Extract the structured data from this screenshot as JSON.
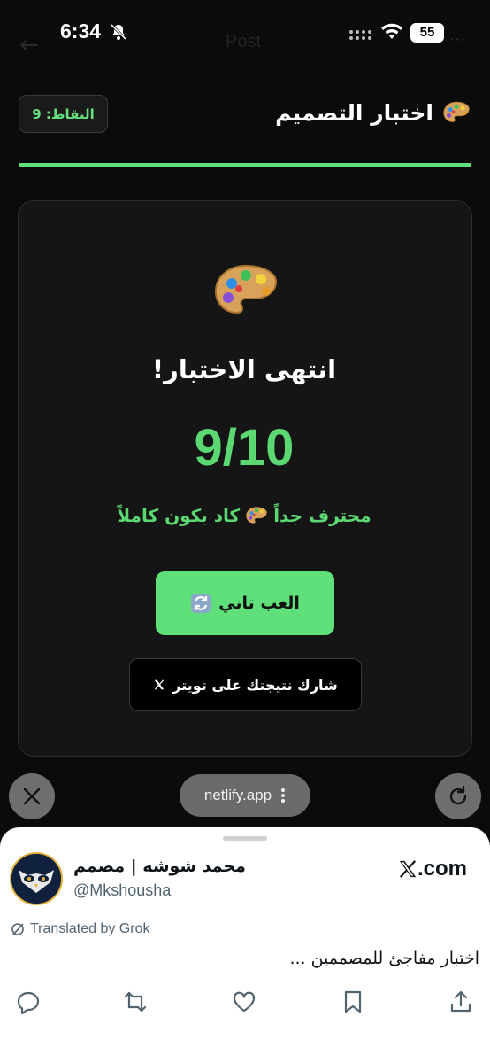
{
  "status_bar": {
    "time": "6:34",
    "battery": "55",
    "ghost_title": "Post"
  },
  "quiz": {
    "title": "اختبار التصميم",
    "score_pill": "النقاط: 9",
    "progress_fraction": 1.0,
    "result_title": "انتهى الاختبار!",
    "score": "9/10",
    "verdict_before": "محترف جداً",
    "verdict_after": "كاد يكون كاملاً",
    "play_again_label": "العب تاني",
    "share_label": "شارك نتيجتك على تويتر"
  },
  "browser": {
    "url": "netlify.app"
  },
  "tweet": {
    "author_name": "محمد شوشه | مصمم",
    "author_handle": "@Mkshousha",
    "site": ".com",
    "translated_label": "Translated by Grok",
    "text": "اختبار مفاجئ للمصممين ..."
  },
  "colors": {
    "accent_green": "#5fe07a",
    "background": "#0b0b0b",
    "card": "#151515"
  },
  "icons": [
    "back-icon",
    "bell-off-icon",
    "signal-icon",
    "wifi-icon",
    "battery-icon",
    "palette-icon",
    "refresh-icon",
    "x-logo-icon",
    "close-icon",
    "more-vertical-icon",
    "reload-icon",
    "grok-icon",
    "reply-icon",
    "repost-icon",
    "like-icon",
    "bookmark-icon",
    "share-icon"
  ]
}
